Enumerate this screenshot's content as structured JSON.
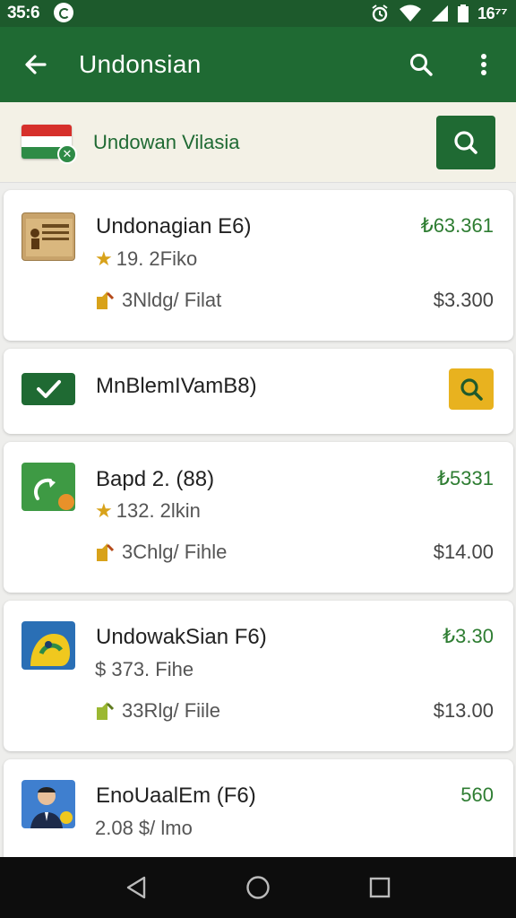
{
  "status_bar": {
    "time": "35:6",
    "clock": "16⁷⁷"
  },
  "app_bar": {
    "title": "Undonsian"
  },
  "filter": {
    "label": "Undowan Vilasia"
  },
  "colors": {
    "primary": "#1f6a33",
    "price_green": "#2e7d32",
    "accent_yellow": "#e8b21f"
  },
  "items": [
    {
      "title": "Undonagian E6)",
      "price_top": "₺63.361",
      "meta": "19. 2Fiko",
      "meta_icon": "star-icon",
      "sub": "3Nldg/ Filat",
      "price_bottom": "$3.300",
      "thumb_icon": "box-thumbnail-icon"
    },
    {
      "title": "MnBlemIVamB8)",
      "check_icon": "check-icon",
      "action_icon": "search-icon"
    },
    {
      "title": "Bapd 2. (88)",
      "price_top": "₺5331",
      "meta": "132. 2lkin",
      "meta_icon": "star-icon",
      "sub": "3Chlg/ Fihle",
      "price_bottom": "$14.00",
      "thumb_icon": "leaf-thumbnail-icon"
    },
    {
      "title": "UndowakSian F6)",
      "price_top": "₺3.30",
      "meta": "$ 373. Fihe",
      "meta_icon": "dollar-icon",
      "sub": "33Rlg/ Fiile",
      "price_bottom": "$13.00",
      "thumb_icon": "bird-thumbnail-icon"
    },
    {
      "title": "EnoUaalEm (F6)",
      "price_top": "560",
      "meta": "2.08 $/ lmo",
      "thumb_icon": "person-thumbnail-icon"
    }
  ],
  "nav": {
    "back": "back-nav-icon",
    "home": "home-nav-icon",
    "recents": "recents-nav-icon"
  }
}
